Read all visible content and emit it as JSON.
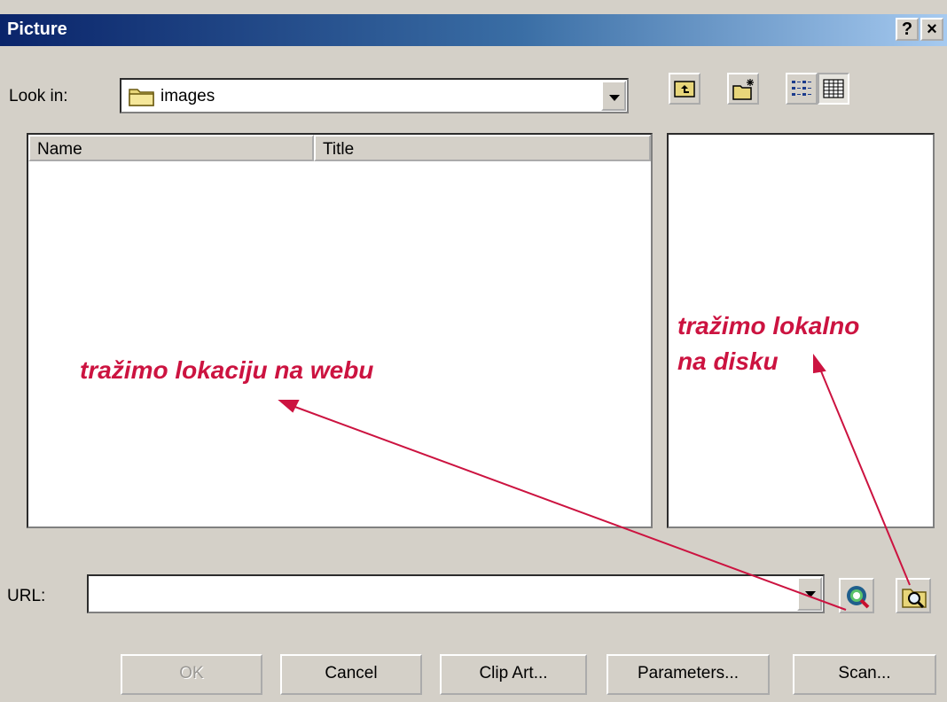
{
  "window": {
    "title": "Picture",
    "help_label": "?",
    "close_label": "×"
  },
  "look_in": {
    "label": "Look in:",
    "value": "images"
  },
  "file_list": {
    "columns": [
      "Name",
      "Title"
    ]
  },
  "url": {
    "label": "URL:",
    "value": ""
  },
  "buttons": {
    "ok": "OK",
    "cancel": "Cancel",
    "clip_art": "Clip Art...",
    "parameters": "Parameters...",
    "scan": "Scan..."
  },
  "annotations": {
    "web": "tražimo lokaciju na webu",
    "local_line1": "tražimo lokalno",
    "local_line2": "na disku"
  },
  "colors": {
    "annotation": "#cc1340",
    "dialog": "#d4d0c8",
    "titlebar": "#0a246a"
  },
  "icons": [
    "up-folder-icon",
    "new-folder-icon",
    "list-view-icon",
    "details-view-icon",
    "folder-icon",
    "web-search-icon",
    "browse-local-icon"
  ]
}
